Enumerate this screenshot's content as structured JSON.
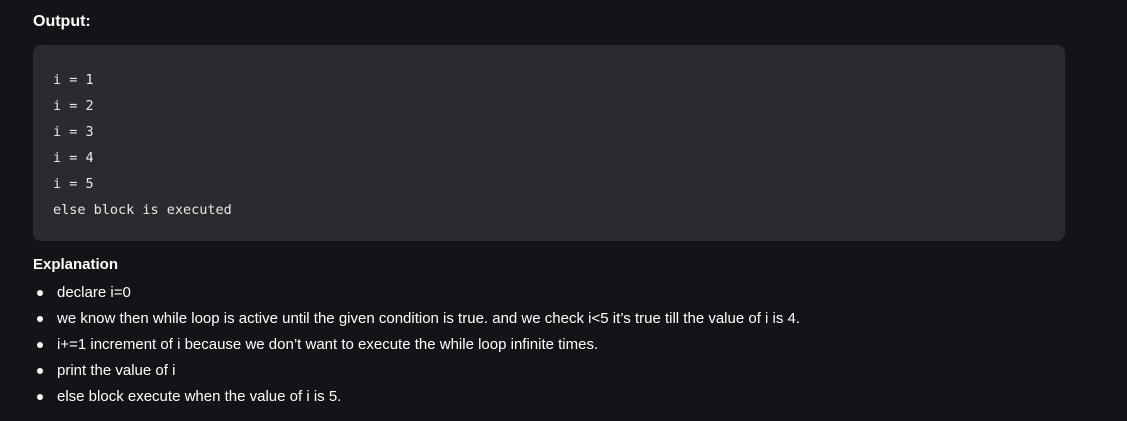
{
  "output": {
    "heading": "Output:",
    "lines": [
      "i = 1",
      "i = 2",
      "i = 3",
      "i = 4",
      "i = 5",
      "else block is executed"
    ]
  },
  "explanation": {
    "heading": "Explanation",
    "items": [
      "declare i=0",
      "we know then while loop is active until the given condition is true. and we check i<5 it’s true till the value of i is 4.",
      "i+=1 increment of i because we don’t want to execute the while loop infinite times.",
      "print the value of i",
      "else block execute when the value of i is 5."
    ]
  }
}
